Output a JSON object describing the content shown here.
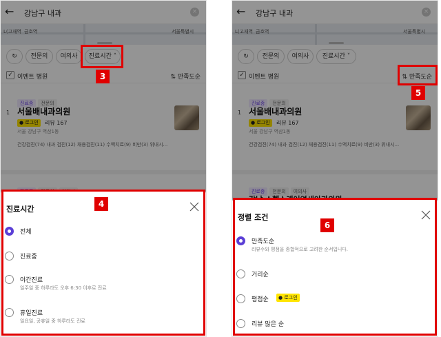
{
  "colors": {
    "accent": "#5b3fd6",
    "annotation": "#e00000",
    "login_badge": "#ffe400"
  },
  "left": {
    "search": {
      "query": "강남구 내과",
      "back_icon": "arrow-left-icon",
      "clear_icon": "clear-icon"
    },
    "map_labels": [
      "L(고재역",
      "금호역",
      "서울특별시"
    ],
    "filters": {
      "reset_icon": "refresh-icon",
      "specialist": "전문의",
      "female_doctor": "여의사",
      "hours": "진료시간",
      "hours_icon": "chevron-up-icon"
    },
    "event_label": "이벤트 병원",
    "sort_label": "만족도순",
    "listing": {
      "tags": [
        "진료중",
        "전문의"
      ],
      "rank": "1",
      "name": "서울배내과의원",
      "login_badge": "로그인",
      "review": "리뷰 167",
      "address": "서울 강남구 역삼1동",
      "services": "건강검진(74)   내과 검진(12)   채용검진(11)   수액치료(9)   비만(3)   위내시..."
    },
    "listing2_tags": [
      "진료중",
      "전문의",
      "여의사"
    ],
    "sheet": {
      "title": "진료시간",
      "close_icon": "close-icon",
      "options": [
        {
          "label": "전체",
          "desc": "",
          "selected": true
        },
        {
          "label": "진료중",
          "desc": "",
          "selected": false
        },
        {
          "label": "야간진료",
          "desc": "일주일 중 하루라도 오후 6:30 이후로 진료",
          "selected": false
        },
        {
          "label": "휴일진료",
          "desc": "일요일, 공휴일 중 하루라도 진료",
          "selected": false
        }
      ]
    },
    "annotations": {
      "hours_chip": "3",
      "sheet": "4"
    }
  },
  "right": {
    "search": {
      "query": "강남구 내과"
    },
    "map_labels": [
      "L(고재역",
      "금호역",
      "서울특별시"
    ],
    "filters": {
      "specialist": "전문의",
      "female_doctor": "여의사",
      "hours": "진료시간",
      "hours_icon": "chevron-down-icon"
    },
    "event_label": "이벤트 병원",
    "sort_label": "만족도순",
    "sort_icon": "sort-icon",
    "listing": {
      "tags": [
        "진료중",
        "전문의"
      ],
      "rank": "1",
      "name": "서울배내과의원",
      "login_badge": "로그인",
      "review": "리뷰 167",
      "address": "서울 강남구 역삼1동",
      "services": "건강검진(74)   내과 검진(12)   채용검진(11)   수액치료(9)   비만(3)   위내시..."
    },
    "listing2_tags": [
      "진료중",
      "전문의",
      "여의사"
    ],
    "listing2_name": "강남 스헬스케어연세아과의원",
    "sheet": {
      "title": "정렬 조건",
      "close_icon": "close-icon",
      "options": [
        {
          "label": "만족도순",
          "desc": "리뷰수와 평점을 종합적으로 고려한 순서입니다.",
          "selected": true
        },
        {
          "label": "거리순",
          "desc": "",
          "selected": false
        },
        {
          "label": "평점순",
          "desc": "",
          "badge": "로그인",
          "selected": false
        },
        {
          "label": "리뷰 많은 순",
          "desc": "",
          "selected": false
        }
      ]
    },
    "annotations": {
      "sort_button": "5",
      "sheet": "6"
    }
  }
}
